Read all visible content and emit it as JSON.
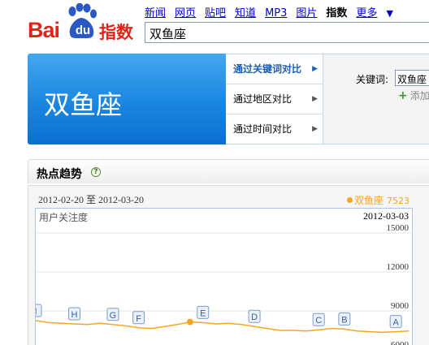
{
  "header": {
    "logo_text": "Bai",
    "logo_du": "du",
    "logo_suffix": "指数",
    "nav": [
      "新闻",
      "网页",
      "贴吧",
      "知道",
      "MP3",
      "图片"
    ],
    "nav_current": "指数",
    "nav_more": "更多",
    "search_value": "双鱼座"
  },
  "banner": {
    "title": "双鱼座"
  },
  "compare_menu": {
    "items": [
      {
        "label": "通过关键词对比",
        "active": true
      },
      {
        "label": "通过地区对比",
        "active": false
      },
      {
        "label": "通过时间对比",
        "active": false
      }
    ]
  },
  "keyword_panel": {
    "label": "关键词:",
    "value": "双鱼座",
    "add_label": "添加"
  },
  "trend": {
    "title": "热点趋势",
    "help_glyph": "?",
    "date_range": "2012-02-20 至 2012-03-20",
    "series_name": "双鱼座",
    "series_value": "7523",
    "plot_label": "用户关注度",
    "hover_date": "2012-03-03",
    "series_color": "#f5a623"
  },
  "chart_data": {
    "type": "line",
    "ylabel": "用户关注度",
    "yticks": [
      6000,
      9000,
      12000,
      15000
    ],
    "ylim": [
      4500,
      16000
    ],
    "y_tick_labels": [
      "6000",
      "9000",
      "12000",
      "15000"
    ],
    "series": [
      {
        "name": "双鱼座",
        "values": [
          8250,
          8100,
          8050,
          8000,
          7950,
          8050,
          7950,
          7850,
          7700,
          7650,
          7800,
          7950,
          8150,
          8100,
          8000,
          8050,
          7950,
          7800,
          7650,
          7500,
          7500,
          7450,
          7550,
          7650,
          7600,
          7450,
          7400,
          7350,
          7400,
          7450
        ]
      }
    ],
    "highlight_index": 12,
    "news_markers": [
      {
        "label": "I",
        "index": 0
      },
      {
        "label": "H",
        "index": 3
      },
      {
        "label": "G",
        "index": 6
      },
      {
        "label": "F",
        "index": 8
      },
      {
        "label": "E",
        "index": 13
      },
      {
        "label": "D",
        "index": 17
      },
      {
        "label": "C",
        "index": 22
      },
      {
        "label": "B",
        "index": 24
      },
      {
        "label": "A",
        "index": 28
      }
    ]
  }
}
